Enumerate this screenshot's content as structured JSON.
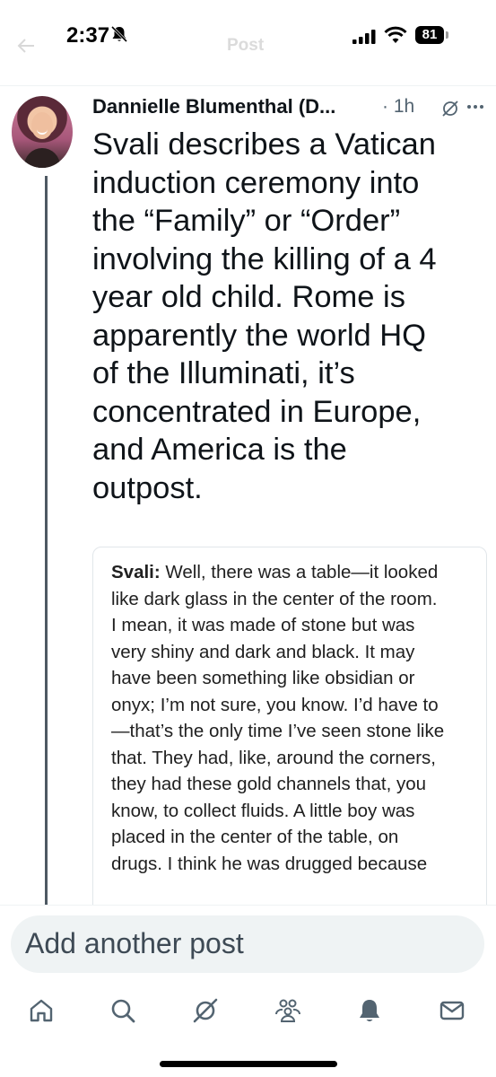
{
  "status_bar": {
    "time": "2:37",
    "battery": "81"
  },
  "header": {
    "title": "Post"
  },
  "post": {
    "author": "Dannielle Blumenthal (D...",
    "time_ago": "· 1h",
    "text": "Svali describes a Vatican\ninduction ceremony into\nthe “Family” or “Order”\ninvolving the killing of a 4\nyear old child. Rome is\napparently the world HQ\nof the Illuminati, it’s\nconcentrated in Europe,\nand America is the\noutpost."
  },
  "quote_image": {
    "speaker": "Svali:",
    "text": " Well, there was a table—it looked\nlike dark glass in the center of the room.\nI mean, it was made of stone but was\nvery shiny and dark and black. It may\nhave been something like obsidian or\nonyx; I’m not sure, you know. I’d have to\n—that’s the only time I’ve seen stone like\nthat. They had, like, around the corners,\nthey had these gold channels that, you\nknow, to collect fluids. A little boy was\nplaced in the center of the table, on\ndrugs. I think he was drugged because"
  },
  "composer": {
    "placeholder": "Add another post"
  },
  "tabs": [
    {
      "icon": "home-icon"
    },
    {
      "icon": "search-icon"
    },
    {
      "icon": "grok-icon"
    },
    {
      "icon": "communities-icon"
    },
    {
      "icon": "notifications-icon"
    },
    {
      "icon": "messages-icon"
    }
  ]
}
